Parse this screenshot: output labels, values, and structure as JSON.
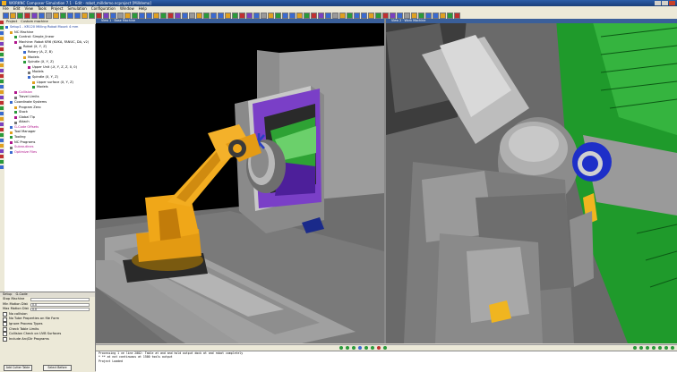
{
  "window": {
    "title": "WORKNC Composer Simulation 7.1 · Edit · robot_milldemo.ncproject [Milldemo]"
  },
  "menu": [
    "File",
    "Edit",
    "View",
    "Tools",
    "Project",
    "Simulation",
    "Configuration",
    "Window",
    "Help"
  ],
  "project_panel": {
    "tabs": [
      "Project",
      "Custom machine"
    ],
    "tree": [
      {
        "label": "Setup1 - KR120 Milling Robot Mount 4 mm",
        "level": 0,
        "color": "#1b3f9a"
      },
      {
        "label": "NC Machine",
        "level": 1,
        "color": "#000"
      },
      {
        "label": "Control: Simple_linear",
        "level": 2,
        "color": "#000"
      },
      {
        "label": "Machine: Robot KR6 (KUKA, FANUC, DA, v2)",
        "level": 2,
        "color": "#000"
      },
      {
        "label": "Robot (X, Y, Z)",
        "level": 3,
        "color": "#000"
      },
      {
        "label": "Rotary (A, Z, B)",
        "level": 4,
        "color": "#000"
      },
      {
        "label": "Models",
        "level": 4,
        "color": "#000"
      },
      {
        "label": "Spindle (X, Y, Z)",
        "level": 4,
        "color": "#000"
      },
      {
        "label": "Upper Unit (-X, Y, Z, Z, 0, 0)",
        "level": 5,
        "color": "#000"
      },
      {
        "label": "Models",
        "level": 5,
        "color": "#000"
      },
      {
        "label": "Spindle (X, Y, Z)",
        "level": 5,
        "color": "#000"
      },
      {
        "label": "Upper surface (X, Y, Z)",
        "level": 6,
        "color": "#000"
      },
      {
        "label": "Models",
        "level": 6,
        "color": "#000"
      },
      {
        "label": "Collision",
        "level": 2,
        "color": "#b0158c"
      },
      {
        "label": "Travel Limits",
        "level": 2,
        "color": "#000"
      },
      {
        "label": "Coordinate Systems",
        "level": 1,
        "color": "#000"
      },
      {
        "label": "Program Zero",
        "level": 2,
        "color": "#000"
      },
      {
        "label": "Stock",
        "level": 2,
        "color": "#000"
      },
      {
        "label": "Global Tip",
        "level": 2,
        "color": "#000"
      },
      {
        "label": "Attach",
        "level": 2,
        "color": "#000"
      },
      {
        "label": "G-Code Offsets",
        "level": 1,
        "color": "#b0158c"
      },
      {
        "label": "Tool Manager",
        "level": 1,
        "color": "#000"
      },
      {
        "label": "Tooling",
        "level": 1,
        "color": "#000"
      },
      {
        "label": "NC Programs",
        "level": 1,
        "color": "#000"
      },
      {
        "label": "Subroutines",
        "level": 1,
        "color": "#b0158c"
      },
      {
        "label": "Optimize Files",
        "level": 1,
        "color": "#b0158c"
      }
    ]
  },
  "properties": {
    "tabs": [
      "Setup",
      "G-Code"
    ],
    "fields": [
      {
        "label": "Stop Machine",
        "value": ""
      },
      {
        "label": "Min Motion Dist",
        "value": "0.0"
      },
      {
        "label": "Max Motion Dist",
        "value": "0.0"
      }
    ],
    "checks": [
      "No collision",
      "No Tube Properties on file Form",
      "Ignore Process Types",
      "Check Table Limits",
      "Collision Check on UVB Surfaces",
      "Include Arc/Dir Programs"
    ],
    "buttons": [
      "Add Cutter Table",
      "Select Before"
    ]
  },
  "viewports": [
    {
      "title": "View 1 · Base Machine"
    },
    {
      "title": "View 2 · Work Machine"
    }
  ],
  "console": {
    "lines": [
      "Processing 1 ve line 2002: Table at and and hold output dock at and robot completely",
      "* ** at not continuous at 1500 tools output",
      "Project Loaded"
    ]
  }
}
